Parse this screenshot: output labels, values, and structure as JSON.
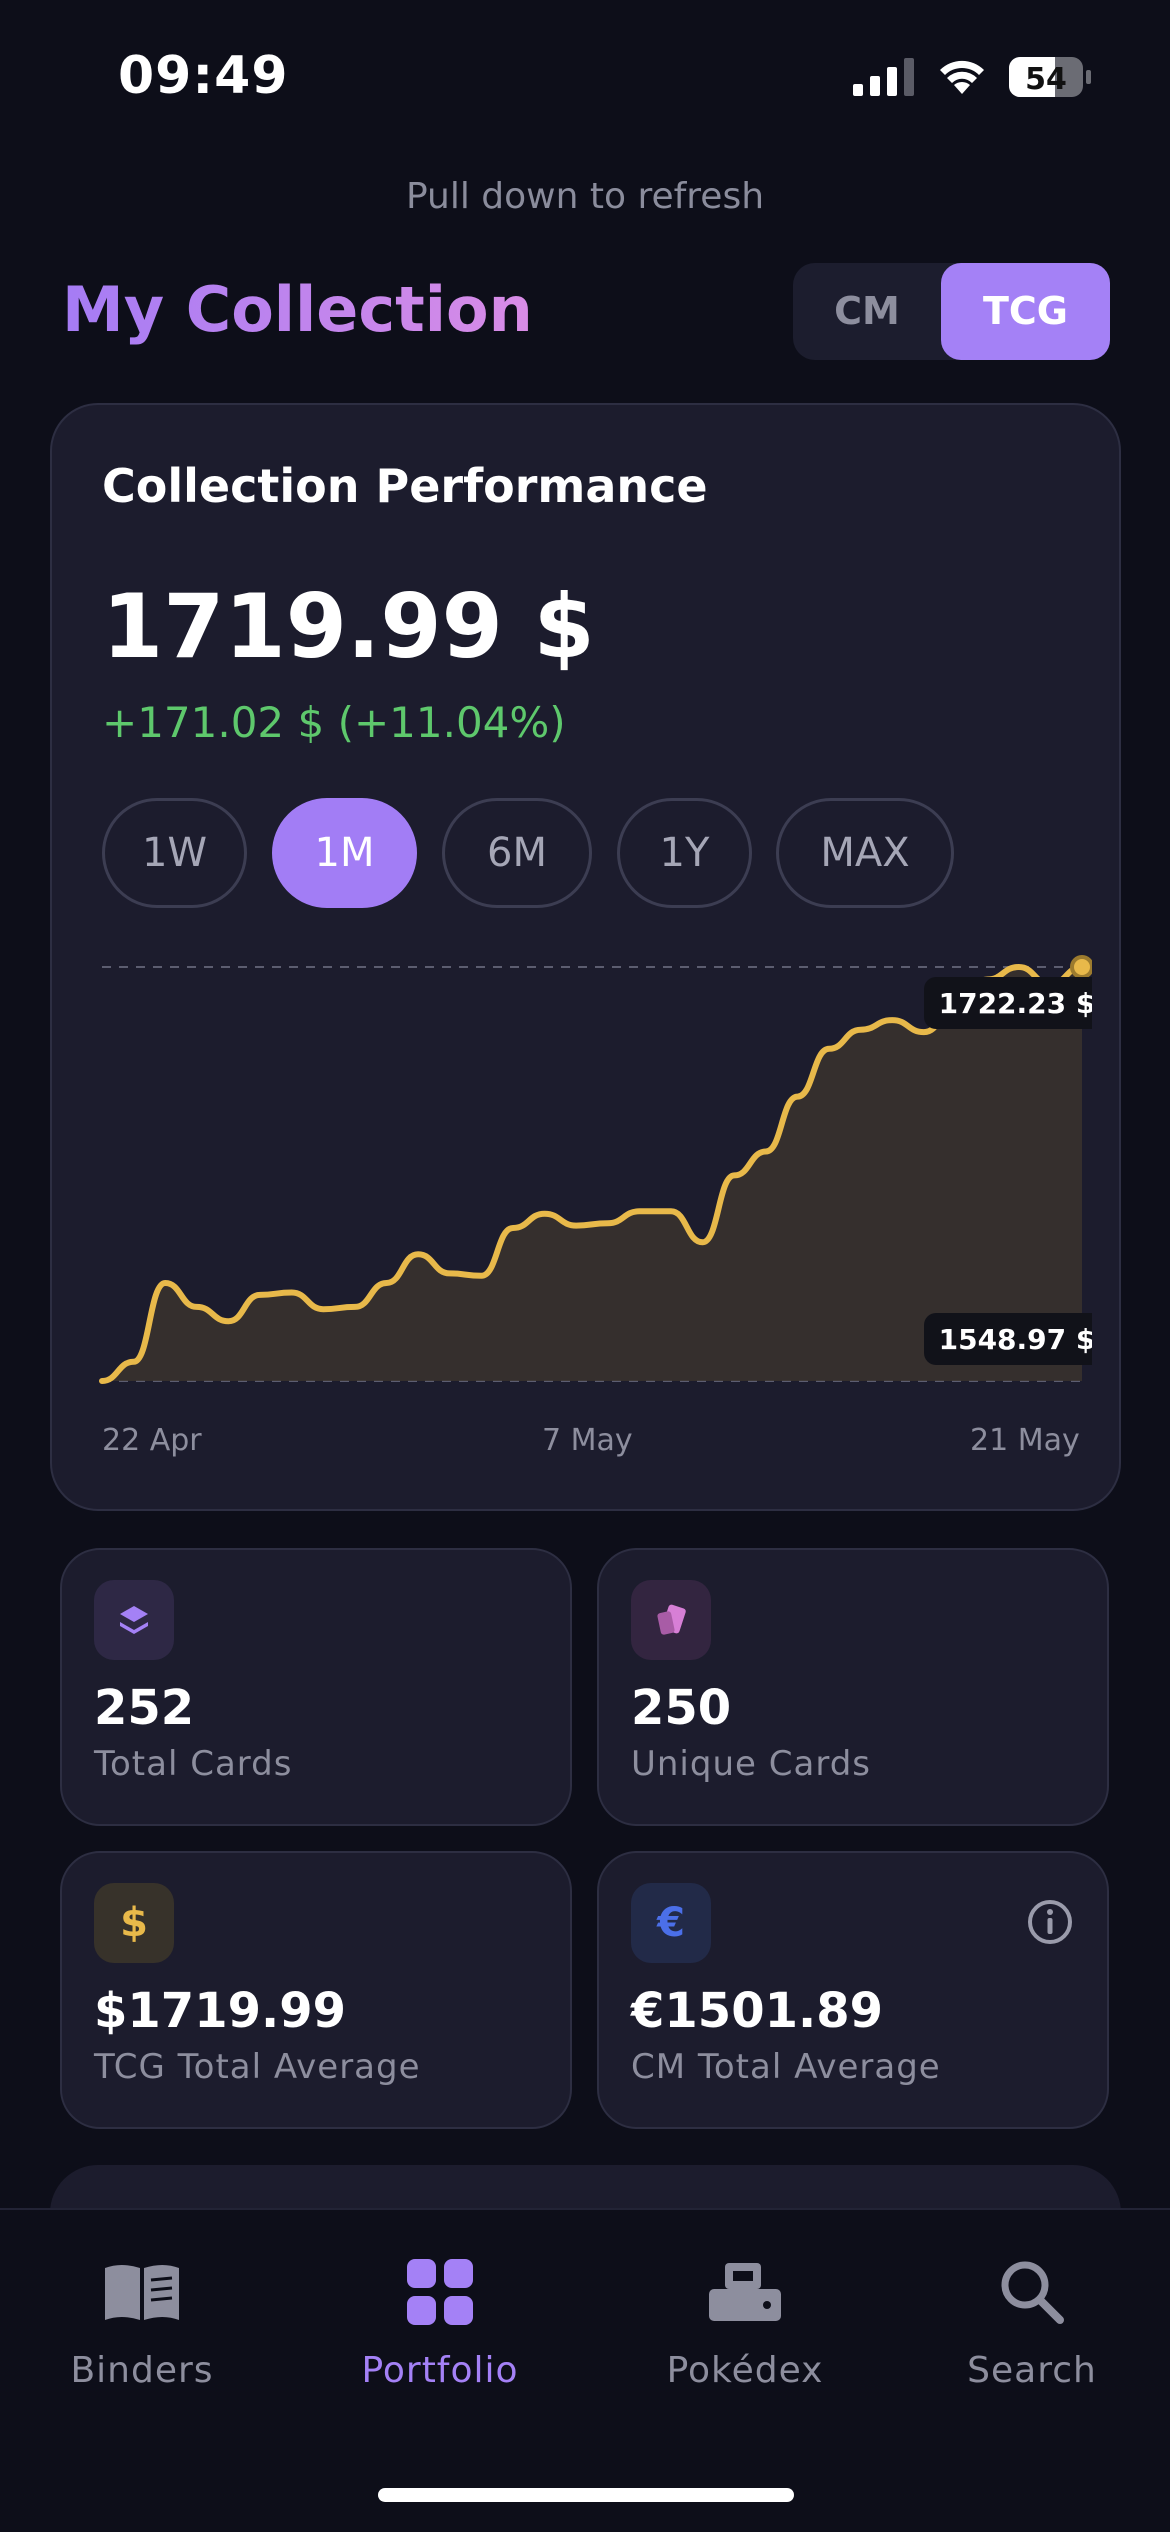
{
  "status_bar": {
    "time": "09:49",
    "battery": "54"
  },
  "refresh_hint": "Pull down to refresh",
  "header": {
    "title": "My Collection",
    "segments": [
      "CM",
      "TCG"
    ],
    "selected_segment": "TCG"
  },
  "performance": {
    "title": "Collection Performance",
    "value": "1719.99 $",
    "change": "+171.02 $ (+11.04%)",
    "ranges": [
      "1W",
      "1M",
      "6M",
      "1Y",
      "MAX"
    ],
    "selected_range": "1M",
    "max_label": "1722.23 $",
    "min_label": "1548.97 $"
  },
  "chart_data": {
    "type": "area",
    "title": "",
    "x_ticks": [
      "22 Apr",
      "7 May",
      "21 May"
    ],
    "ylabel": "",
    "ylim": [
      1548.97,
      1722.23
    ],
    "color": "#e8b94a",
    "values": [
      1548.97,
      1557,
      1590,
      1580,
      1574,
      1585,
      1586,
      1579,
      1580,
      1590,
      1602,
      1594,
      1593,
      1613,
      1619,
      1614,
      1615,
      1620,
      1620,
      1607,
      1635,
      1645,
      1668,
      1688,
      1696,
      1700,
      1695,
      1705,
      1717,
      1722.23,
      1715,
      1722.23
    ]
  },
  "stats": [
    {
      "value": "252",
      "label": "Total Cards",
      "icon": "layers-icon",
      "color": "#a481f6"
    },
    {
      "value": "250",
      "label": "Unique Cards",
      "icon": "cards-icon",
      "color": "#d77fd6"
    },
    {
      "value": "$1719.99",
      "label": "TCG Total Average",
      "icon": "dollar-icon",
      "glyph": "$",
      "color": "#e8b94a"
    },
    {
      "value": "€1501.89",
      "label": "CM Total Average",
      "icon": "euro-icon",
      "glyph": "€",
      "color": "#4b6fe8"
    }
  ],
  "tabs": [
    {
      "label": "Binders",
      "icon": "book-icon"
    },
    {
      "label": "Portfolio",
      "icon": "grid-icon"
    },
    {
      "label": "Pokédex",
      "icon": "pokedex-icon"
    },
    {
      "label": "Search",
      "icon": "search-icon"
    }
  ],
  "selected_tab": "Portfolio"
}
